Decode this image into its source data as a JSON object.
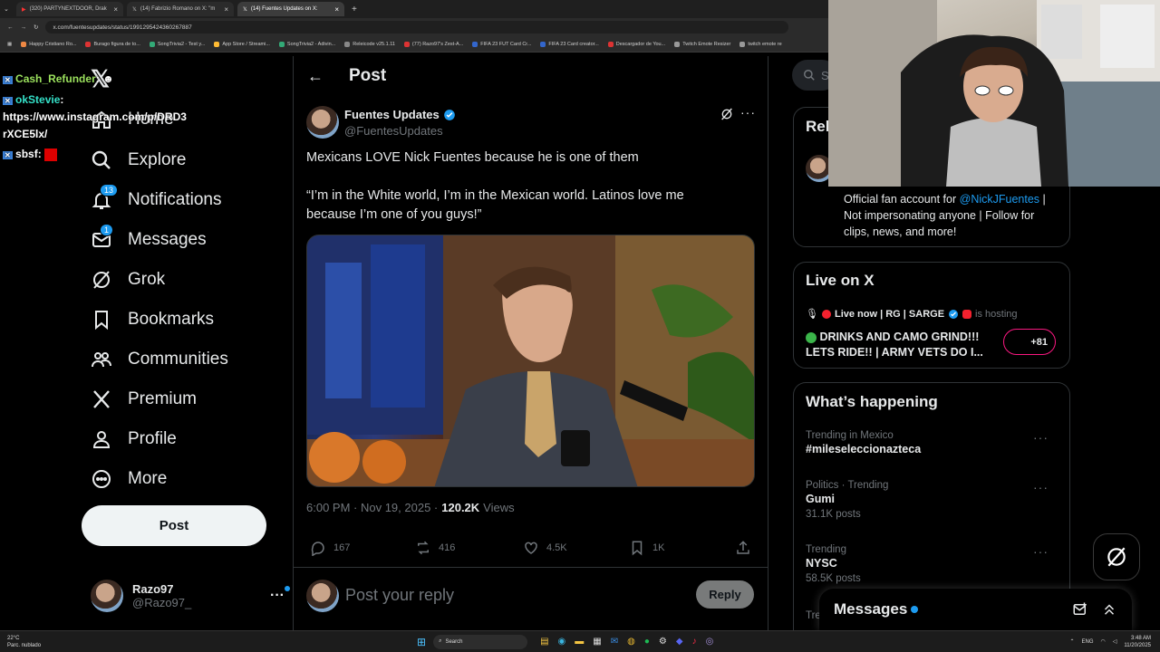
{
  "browser": {
    "tabs": [
      {
        "label": "(320) PARTYNEXTDOOR, Drak"
      },
      {
        "label": "(14) Fabrizio Romano on X: \"m"
      },
      {
        "label": "(14) Fuentes Updates on X:"
      }
    ],
    "url": "x.com/fuentesupdates/status/1991295424360267887",
    "bookmarks": [
      "Happy Cristiano Ro...",
      "Burago figura de to...",
      "SongTrivia2 - Test y...",
      "App Store / Streami...",
      "SongTrivia2 - Adivin...",
      "Releicode v25.1.11",
      "(77) Razo97's Zest-A...",
      "FIFA 23 FUT Card Cr...",
      "FIFA 23 Card creator...",
      "Descargador de You...",
      "Twitch Emote Resizer",
      "twitch emote re"
    ]
  },
  "chat": {
    "line1_user": "Cash_Refunder",
    "line1_msg": ":",
    "line2_user": "okStevie",
    "line2_msg": ":",
    "line3": "https://www.instagram.com/p/DRD3",
    "line4": "rXCE5lx/",
    "line5_user": "sbsf",
    "line5_msg": ":"
  },
  "nav": {
    "home": "Home",
    "explore": "Explore",
    "notifications": "Notifications",
    "notifications_badge": "13",
    "messages": "Messages",
    "messages_badge": "1",
    "grok": "Grok",
    "bookmarks": "Bookmarks",
    "communities": "Communities",
    "premium": "Premium",
    "profile": "Profile",
    "more": "More",
    "post_button": "Post"
  },
  "account": {
    "name": "Razo97",
    "handle": "@Razo97_"
  },
  "post": {
    "header_title": "Post",
    "author_name": "Fuentes Updates",
    "author_handle": "@FuentesUpdates",
    "text_line1": "Mexicans LOVE Nick Fuentes because he is one of them",
    "text_line2": "“I’m in the White world, I’m in the Mexican world. Latinos love me",
    "text_line3": "because I’m one of you guys!”",
    "timestamp": "6:00 PM · Nov 19, 2025 ·",
    "views_count": "120.2K",
    "views_label": "Views",
    "replies": "167",
    "reposts": "416",
    "likes": "4.5K",
    "bookmarks": "1K",
    "reply_placeholder": "Post your reply",
    "reply_button": "Reply"
  },
  "sidebar": {
    "search_placeholder": "S",
    "relevant_title": "Rel",
    "bio_prefix": "Official fan account for",
    "bio_mention": "@NickJFuentes",
    "bio_rest_1": "| Not impersonating anyone | Follow for",
    "bio_rest_2": "clips, news, and more!",
    "live_title": "Live on X",
    "live_line": "Live now | RG | SARGE",
    "live_hosting": "is hosting",
    "live_desc_1": "DRINKS AND CAMO GRIND!!!",
    "live_desc_2": "LETS RIDE!! | ARMY VETS DO I...",
    "live_count": "+81",
    "happening_title": "What’s happening",
    "trends": [
      {
        "context": "Trending in Mexico",
        "name": "#mileseleccionazteca",
        "posts": ""
      },
      {
        "context": "Politics · Trending",
        "name": "Gumi",
        "posts": "31.1K posts"
      },
      {
        "context": "Trending",
        "name": "NYSC",
        "posts": "58.5K posts"
      }
    ],
    "trend_partial": "Tre",
    "messages_drawer": "Messages"
  },
  "taskbar": {
    "weather_temp": "22°C",
    "weather_desc": "Parc. nublado",
    "search": "Search",
    "lang": "ENG",
    "time": "3:48 AM",
    "date": "11/20/2025"
  },
  "colors": {
    "accent": "#1d9bf0",
    "bg": "#000000",
    "text": "#e7e9ea",
    "muted": "#71767b",
    "border": "#2f3336"
  }
}
